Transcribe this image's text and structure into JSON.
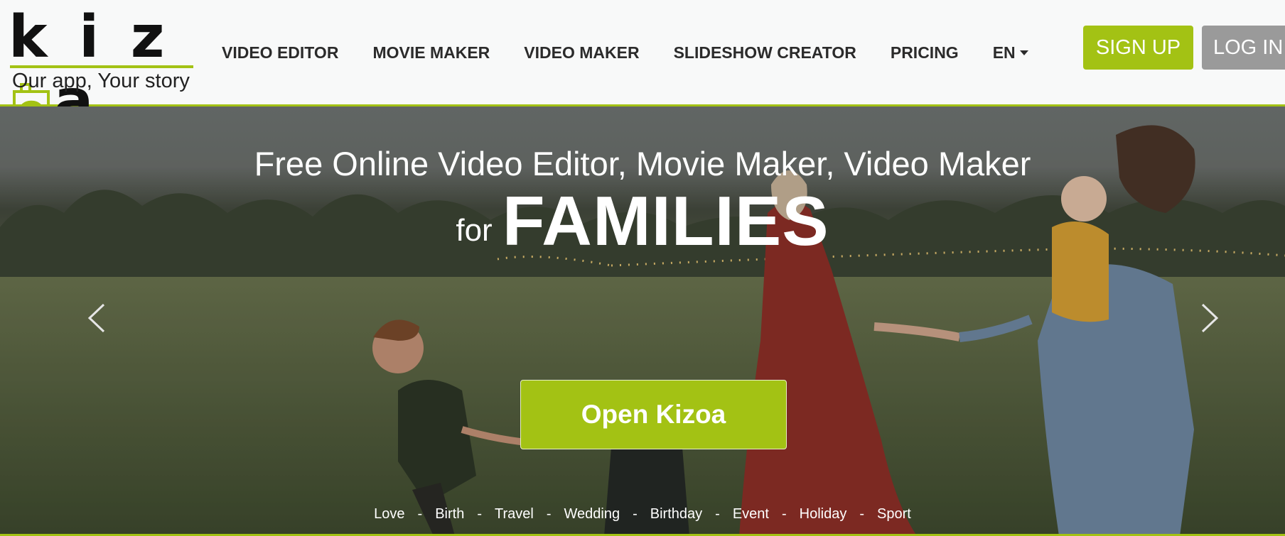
{
  "header": {
    "logo_text": "kizoa",
    "tagline": "Our app, Your story",
    "nav": [
      {
        "label": "VIDEO EDITOR"
      },
      {
        "label": "MOVIE MAKER"
      },
      {
        "label": "VIDEO MAKER"
      },
      {
        "label": "SLIDESHOW CREATOR"
      },
      {
        "label": "PRICING"
      }
    ],
    "language": "EN",
    "signup_label": "SIGN UP",
    "login_label": "LOG IN"
  },
  "hero": {
    "title": "Free Online Video Editor, Movie Maker, Video Maker",
    "for_text": "for",
    "highlight": "FAMILIES",
    "cta_label": "Open Kizoa",
    "categories": [
      "Love",
      "Birth",
      "Travel",
      "Wedding",
      "Birthday",
      "Event",
      "Holiday",
      "Sport"
    ],
    "separator": "-",
    "prev_icon": "chevron-left-icon",
    "next_icon": "chevron-right-icon"
  },
  "colors": {
    "accent": "#a3c214",
    "login_bg": "#9a9a9a",
    "header_bg": "#f8f9f9",
    "nav_text": "#2b2b2b"
  }
}
